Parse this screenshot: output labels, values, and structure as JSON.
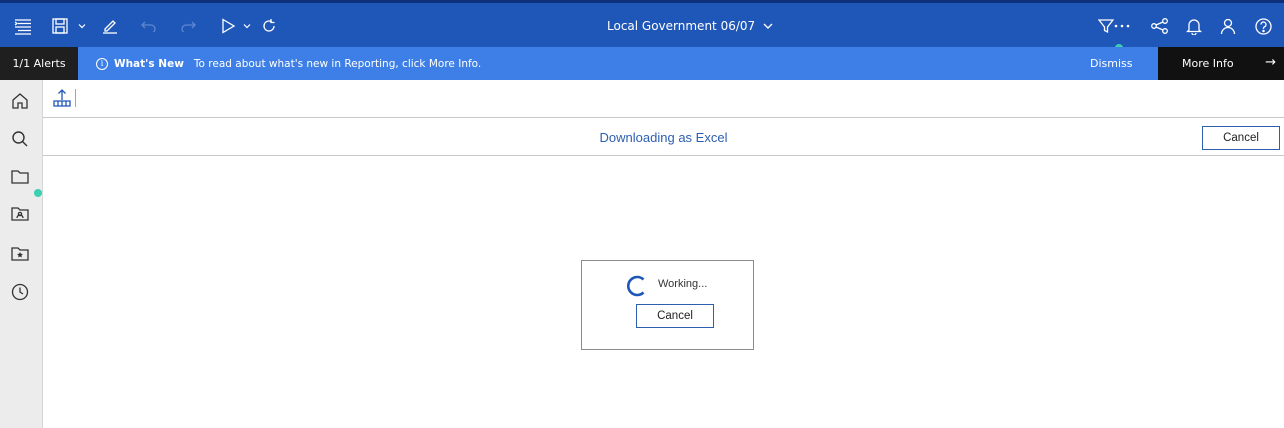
{
  "header": {
    "title": "Local Government 06/07",
    "icons": [
      "hamburger-icon",
      "save-icon",
      "chevron-down-icon",
      "edit-icon",
      "undo-icon",
      "redo-icon",
      "run-icon",
      "chevron-down-icon",
      "refresh-icon",
      "filter-icon",
      "more-icon",
      "share-icon",
      "bell-icon",
      "user-icon",
      "help-icon"
    ],
    "accent": "#1f57b8"
  },
  "alert": {
    "count": "1/1 Alerts",
    "heading": "What's New",
    "message": "To read about what's new in Reporting, click More Info.",
    "dismiss": "Dismiss",
    "more_info": "More Info",
    "bar_color": "#3d7fe6"
  },
  "sidebar": {
    "items": [
      "home-icon",
      "search-icon",
      "folder-icon",
      "team-folder-icon",
      "favorites-folder-icon",
      "recent-icon"
    ]
  },
  "toolbar": {
    "upload_icon": "upload-icon"
  },
  "download": {
    "status": "Downloading as Excel",
    "cancel": "Cancel"
  },
  "dialog": {
    "working": "Working...",
    "cancel": "Cancel"
  }
}
